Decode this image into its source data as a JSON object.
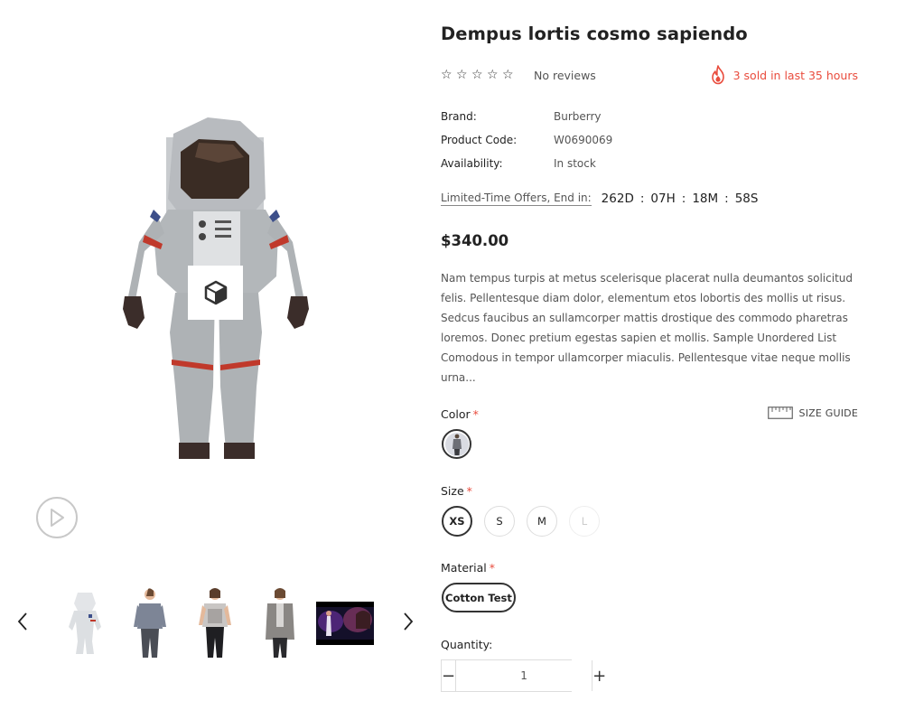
{
  "product": {
    "title": "Dempus lortis cosmo sapiendo",
    "rating_stars": [
      "☆",
      "☆",
      "☆",
      "☆",
      "☆"
    ],
    "reviews_text": "No reviews",
    "sold_text": "3 sold in last 35 hours",
    "meta": [
      {
        "key": "Brand:",
        "value": "Burberry"
      },
      {
        "key": "Product Code:",
        "value": "W0690069"
      },
      {
        "key": "Availability:",
        "value": "In stock"
      }
    ],
    "offer_label": "Limited-Time Offers, End in:",
    "countdown": {
      "days": "262D",
      "hours": "07H",
      "minutes": "18M",
      "seconds": "58S",
      "separator": ":"
    },
    "price": "$340.00",
    "description": "Nam tempus turpis at metus scelerisque placerat nulla deumantos solicitud felis. Pellentesque diam dolor, elementum etos lobortis des mollis ut risus. Sedcus faucibus an sullamcorper mattis drostique des commodo pharetras loremos. Donec pretium egestas sapien et mollis. Sample Unordered List Comodous in tempor ullamcorper miaculis. Pellentesque vitae neque mollis urna..."
  },
  "options": {
    "color_label": "Color",
    "size_label": "Size",
    "material_label": "Material",
    "required_mark": "*",
    "size_guide_label": "SIZE GUIDE",
    "sizes": [
      {
        "label": "XS",
        "state": "selected"
      },
      {
        "label": "S",
        "state": "normal"
      },
      {
        "label": "M",
        "state": "normal"
      },
      {
        "label": "L",
        "state": "disabled"
      }
    ],
    "material_value": "Cotton Test"
  },
  "quantity": {
    "label": "Quantity:",
    "value": "1",
    "minus": "−",
    "plus": "+"
  },
  "colors": {
    "accent_red": "#e94c3d",
    "text_dark": "#222222",
    "text_muted": "#555555",
    "border": "#dddddd"
  },
  "icons": {
    "ar": "cube-icon",
    "play": "play-icon",
    "prev": "chevron-left-icon",
    "next": "chevron-right-icon",
    "fire": "fire-icon",
    "ruler": "ruler-icon",
    "star": "star-outline-icon"
  }
}
